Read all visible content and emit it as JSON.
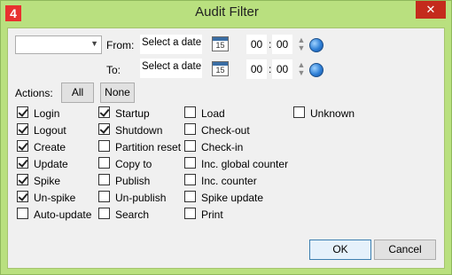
{
  "window": {
    "title": "Audit Filter",
    "app_badge": "4",
    "close_glyph": "✕"
  },
  "filter": {
    "from_label": "From:",
    "to_label": "To:",
    "from_date_placeholder": "Select a date",
    "to_date_placeholder": "Select a date",
    "from_hour": "00",
    "from_minute": "00",
    "to_hour": "00",
    "to_minute": "00",
    "time_sep": ":",
    "calendar_day": "15"
  },
  "actions": {
    "label": "Actions:",
    "all_label": "All",
    "none_label": "None"
  },
  "columns": [
    [
      {
        "label": "Login",
        "checked": true
      },
      {
        "label": "Logout",
        "checked": true
      },
      {
        "label": "Create",
        "checked": true
      },
      {
        "label": "Update",
        "checked": true
      },
      {
        "label": "Spike",
        "checked": true
      },
      {
        "label": "Un-spike",
        "checked": true
      },
      {
        "label": "Auto-update",
        "checked": false
      }
    ],
    [
      {
        "label": "Startup",
        "checked": true
      },
      {
        "label": "Shutdown",
        "checked": true
      },
      {
        "label": "Partition reset",
        "checked": false
      },
      {
        "label": "Copy to",
        "checked": false
      },
      {
        "label": "Publish",
        "checked": false
      },
      {
        "label": "Un-publish",
        "checked": false
      },
      {
        "label": "Search",
        "checked": false
      }
    ],
    [
      {
        "label": "Load",
        "checked": false
      },
      {
        "label": "Check-out",
        "checked": false
      },
      {
        "label": "Check-in",
        "checked": false
      },
      {
        "label": "Inc. global counter",
        "checked": false
      },
      {
        "label": "Inc. counter",
        "checked": false
      },
      {
        "label": "Spike update",
        "checked": false
      },
      {
        "label": "Print",
        "checked": false
      }
    ],
    [
      {
        "label": "Unknown",
        "checked": false
      }
    ]
  ],
  "footer": {
    "ok_label": "OK",
    "cancel_label": "Cancel"
  },
  "icons": {
    "app": "app-logo-icon",
    "close": "close-icon",
    "calendar": "calendar-icon",
    "spin": "spin-arrows-icon",
    "globe": "globe-icon",
    "dropdown": "chevron-down-icon"
  }
}
